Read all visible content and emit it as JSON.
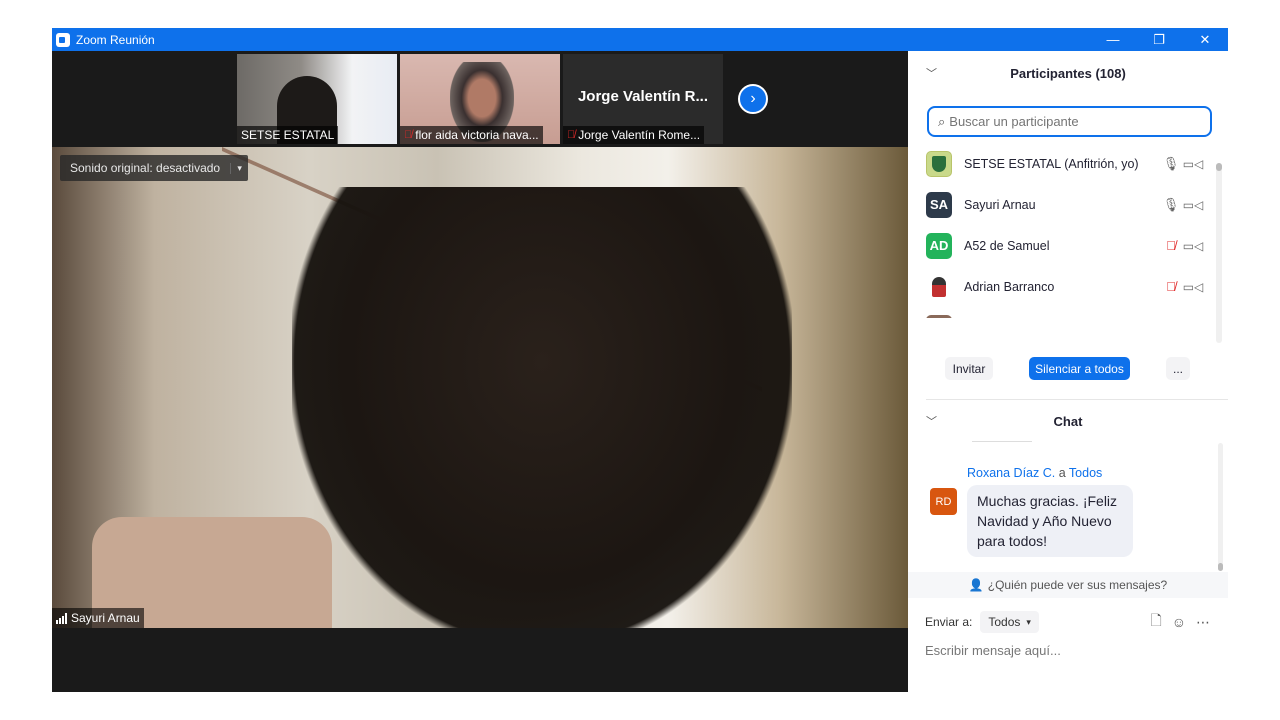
{
  "window": {
    "title": "Zoom Reunión",
    "minimize": "—",
    "restore": "❐",
    "close": "✕"
  },
  "colors": {
    "accent": "#0e71eb",
    "muted": "#e02828",
    "chat_avatar": "#d8560f"
  },
  "strip": {
    "thumbnails": [
      {
        "label": "SETSE ESTATAL",
        "muted": false
      },
      {
        "label": "flor aida victoria nava...",
        "muted": true
      },
      {
        "label": "Jorge Valentín Rome...",
        "big_name": "Jorge Valentín R...",
        "muted": true
      }
    ],
    "next_icon": "›"
  },
  "main_video": {
    "sound_button": "Sonido original: desactivado",
    "sound_arrow": "▾",
    "speaker": "Sayuri Arnau"
  },
  "participants": {
    "header": "Participantes (108)",
    "search_placeholder": "Buscar un participante",
    "list": [
      {
        "name": "SETSE ESTATAL (Anfitrión, yo)",
        "avatar": "",
        "avatar_color": "#c9d98a",
        "mic": "on"
      },
      {
        "name": "Sayuri Arnau",
        "avatar": "SA",
        "avatar_color": "#2d3a4a",
        "mic": "on"
      },
      {
        "name": "A52 de Samuel",
        "avatar": "AD",
        "avatar_color": "#23b35b",
        "mic": "off"
      },
      {
        "name": "Adrian Barranco",
        "avatar": "",
        "avatar_color": "#ffffff",
        "mic": "off"
      }
    ],
    "buttons": {
      "invite": "Invitar",
      "mute_all": "Silenciar a todos",
      "more": "..."
    }
  },
  "chat": {
    "header": "Chat",
    "message": {
      "sender": "Roxana Díaz C.",
      "connector": "a",
      "recipient": "Todos",
      "initials": "RD",
      "text": "Muchas gracias. ¡Feliz Navidad y Año Nuevo para todos!"
    },
    "who_can_see": "¿Quién puede ver sus mensajes?",
    "send_to_label": "Enviar a:",
    "send_to_value": "Todos",
    "compose_placeholder": "Escribir mensaje aquí..."
  }
}
